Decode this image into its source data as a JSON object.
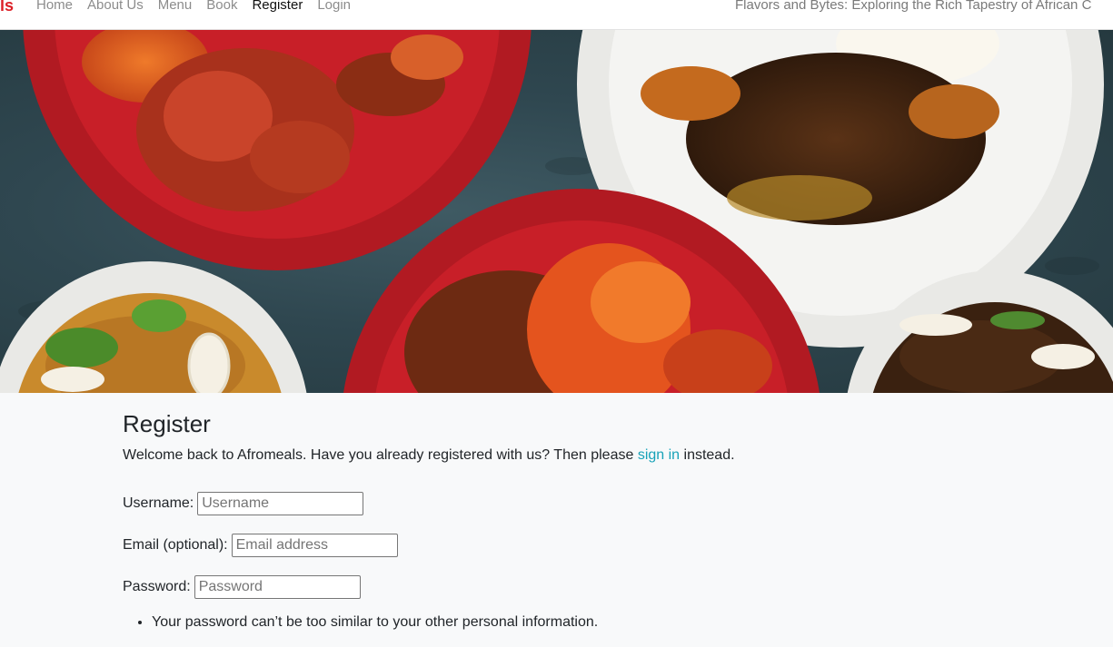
{
  "nav": {
    "brand": "ls",
    "links": [
      {
        "label": "Home",
        "active": false
      },
      {
        "label": "About Us",
        "active": false
      },
      {
        "label": "Menu",
        "active": false
      },
      {
        "label": "Book",
        "active": false
      },
      {
        "label": "Register",
        "active": true
      },
      {
        "label": "Login",
        "active": false
      }
    ],
    "tagline": "Flavors and Bytes: Exploring the Rich Tapestry of African C"
  },
  "colors": {
    "brand": "#dc1f26",
    "link": "#17a2b8",
    "nav_inactive": "#8c8c8c",
    "background": "#f8f9fa"
  },
  "hero": {
    "image": "african-food-plates"
  },
  "form": {
    "title": "Register",
    "intro_before": "Welcome back to Afromeals. Have you already registered with us? Then please ",
    "intro_link": "sign in",
    "intro_after": " instead.",
    "username_label": "Username:",
    "username_placeholder": "Username",
    "email_label": "Email (optional):",
    "email_placeholder": "Email address",
    "password_label": "Password:",
    "password_placeholder": "Password",
    "help_items": [
      "Your password can’t be too similar to your other personal information."
    ]
  }
}
